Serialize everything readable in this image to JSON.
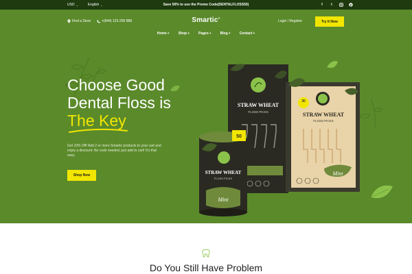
{
  "topbar": {
    "currency": "USD",
    "language": "English",
    "promo": "Save 50% to use the Promo Code(DENTALFLOSS50)",
    "social_icons": [
      "facebook-icon",
      "twitter-icon",
      "instagram-icon",
      "pinterest-icon"
    ]
  },
  "header": {
    "find_store": "Find a Store",
    "phone": "+(844) 123-209 888",
    "logo": "Smartic",
    "login": "Login / Register",
    "cta": "Try It Now"
  },
  "nav": [
    {
      "label": "Home"
    },
    {
      "label": "Shop"
    },
    {
      "label": "Pages"
    },
    {
      "label": "Blog"
    },
    {
      "label": "Contact"
    }
  ],
  "hero": {
    "line1": "Choose Good",
    "line2": "Dental Floss is",
    "line3": "The Key",
    "description": "Get 10% Off! Add 2 or more Smartic products to your cart and enjoy a discount. No code needed, just add to cart! It's that easy.",
    "button": "Shop Now"
  },
  "products": {
    "brand": "STRAW WHEAT",
    "subtitle": "FLOSS PICKS",
    "mint": "Mint",
    "count_50": "50",
    "count_30": "30"
  },
  "section2": {
    "title": "Do You Still Have Problem"
  },
  "colors": {
    "hero_bg": "#5b8a2b",
    "topbar_bg": "#1e3a0e",
    "accent_yellow": "#f2e600",
    "box_dark": "#2a2a22"
  }
}
